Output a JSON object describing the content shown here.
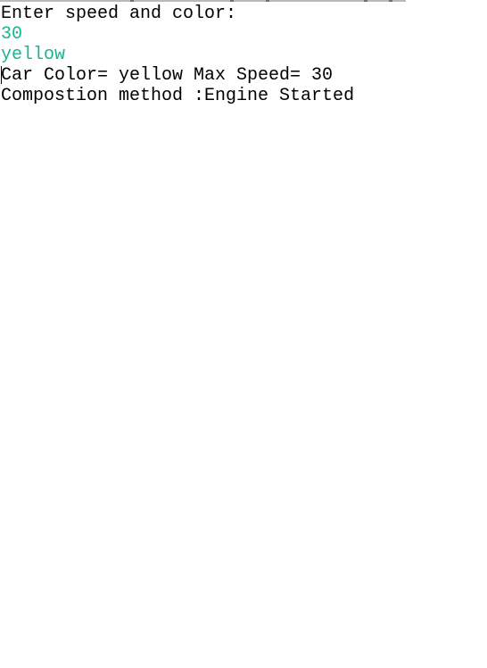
{
  "console": {
    "lines": [
      {
        "text": "Enter speed and color:",
        "kind": "output"
      },
      {
        "text": "30",
        "kind": "input"
      },
      {
        "text": "yellow",
        "kind": "input"
      },
      {
        "text": "Car Color= yellow Max Speed= 30",
        "kind": "output"
      },
      {
        "text": "Compostion method :Engine Started",
        "kind": "output"
      }
    ]
  },
  "colors": {
    "output_text": "#000000",
    "input_text": "#1bb393",
    "background": "#ffffff"
  }
}
